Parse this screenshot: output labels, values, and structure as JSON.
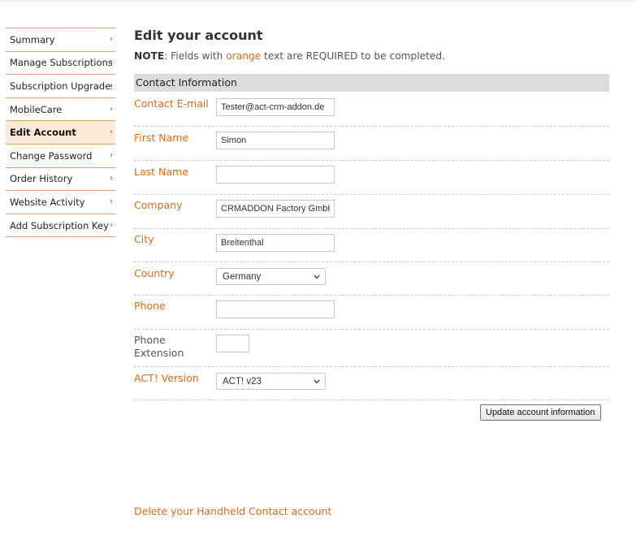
{
  "sidebar": {
    "items": [
      {
        "label": "Summary"
      },
      {
        "label": "Manage Subscriptions"
      },
      {
        "label": "Subscription Upgrades"
      },
      {
        "label": "MobileCare"
      },
      {
        "label": "Edit Account"
      },
      {
        "label": "Change Password"
      },
      {
        "label": "Order History"
      },
      {
        "label": "Website Activity"
      },
      {
        "label": "Add Subscription Key"
      }
    ],
    "active_index": 4,
    "chevron": "›"
  },
  "main": {
    "title": "Edit your account",
    "note": {
      "prefix": "NOTE",
      "text1": ": Fields with ",
      "orange_word": "orange",
      "text2": " text are REQUIRED to be completed."
    },
    "section_title": "Contact Information",
    "fields": {
      "email": {
        "label": "Contact E-mail",
        "value": "Tester@act-crm-addon.de"
      },
      "first_name": {
        "label": "First Name",
        "value": "Simon"
      },
      "last_name": {
        "label": "Last Name",
        "value": ""
      },
      "company": {
        "label": "Company",
        "value": "CRMADDON Factory GmbH"
      },
      "city": {
        "label": "City",
        "value": "Breitenthal"
      },
      "country": {
        "label": "Country",
        "value": "Germany"
      },
      "phone": {
        "label": "Phone",
        "value": ""
      },
      "phone_ext": {
        "label_line1": "Phone",
        "label_line2": "Extension",
        "value": ""
      },
      "act_version": {
        "label": "ACT! Version",
        "value": "ACT! v23"
      }
    },
    "update_button": "Update account information",
    "delete_link": "Delete your Handheld Contact account"
  },
  "colors": {
    "required": "#e06a18",
    "sidebar_border": "#e8a46a",
    "active_bg": "#fde9d8",
    "section_bg": "#dcdcdc"
  },
  "icons": {
    "dropdown": "chevron-down-icon",
    "sidebar_arrow": "chevron-right-icon"
  }
}
